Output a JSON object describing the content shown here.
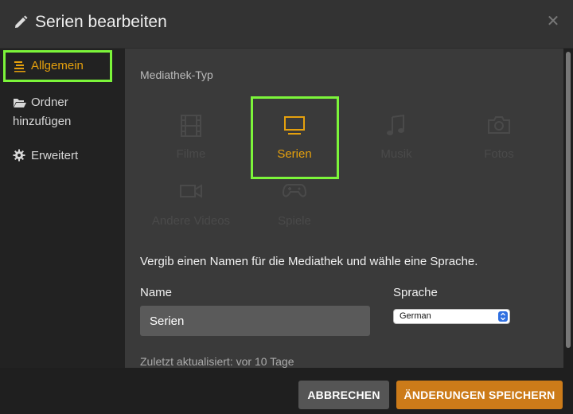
{
  "dialog": {
    "title": "Serien bearbeiten"
  },
  "sidebar": {
    "items": [
      {
        "label": "Allgemein",
        "icon": "list-icon",
        "active": true
      },
      {
        "label": "Ordner hinzufügen",
        "label_line1": "Ordner",
        "label_line2": "hinzufügen",
        "icon": "folder-open-icon"
      },
      {
        "label": "Erweitert",
        "icon": "gear-icon"
      }
    ]
  },
  "library": {
    "section_label": "Mediathek-Typ",
    "types": [
      {
        "label": "Filme",
        "icon": "film-icon"
      },
      {
        "label": "Serien",
        "icon": "tv-icon",
        "selected": true
      },
      {
        "label": "Musik",
        "icon": "music-note-icon"
      },
      {
        "label": "Fotos",
        "icon": "camera-icon"
      },
      {
        "label": "Andere Videos",
        "icon": "video-camera-icon"
      },
      {
        "label": "Spiele",
        "icon": "gamepad-icon"
      }
    ],
    "description": "Vergib einen Namen für die Mediathek und wähle eine Sprache.",
    "name_label": "Name",
    "name_value": "Serien",
    "language_label": "Sprache",
    "language_value": "German",
    "updated": "Zuletzt aktualisiert: vor 10 Tage"
  },
  "footer": {
    "cancel_label": "ABBRECHEN",
    "save_label": "ÄNDERUNGEN SPEICHERN"
  },
  "colors": {
    "accent": "#e5a00d",
    "highlight": "#7cf53a",
    "save_button": "#cc7b19"
  }
}
